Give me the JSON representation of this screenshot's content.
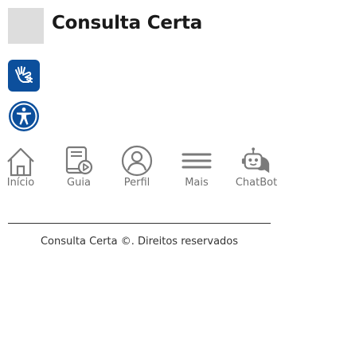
{
  "header": {
    "title": "Consulta Certa"
  },
  "accessibility": {
    "libras_icon": "sign-language-hand-icon",
    "access_icon": "accessibility-person-icon",
    "libras_color": "#0c4f9c"
  },
  "nav": {
    "items": [
      {
        "label": "Início",
        "icon": "home-icon"
      },
      {
        "label": "Guia",
        "icon": "guide-video-icon"
      },
      {
        "label": "Perfil",
        "icon": "profile-icon"
      },
      {
        "label": "Mais",
        "icon": "menu-icon"
      },
      {
        "label": "ChatBot",
        "icon": "chatbot-icon"
      }
    ],
    "label_color": "#707070"
  },
  "footer": {
    "text": "Consulta Certa ©. Direitos reservados"
  }
}
